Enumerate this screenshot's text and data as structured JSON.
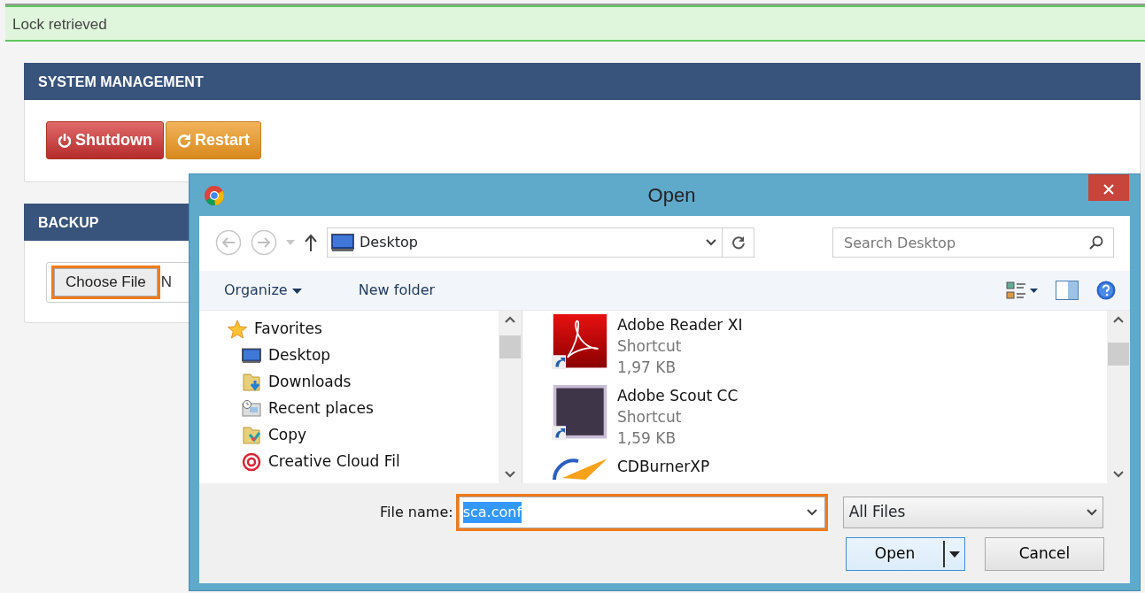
{
  "alert": {
    "text": "Lock retrieved"
  },
  "panels": [
    {
      "title": "SYSTEM MANAGEMENT",
      "buttons": [
        {
          "label": "Shutdown",
          "kind": "danger"
        },
        {
          "label": "Restart",
          "kind": "warning"
        }
      ]
    },
    {
      "title": "BACKUP",
      "file_input": {
        "button": "Choose File",
        "status": "N",
        "highlighted": true
      }
    }
  ],
  "dialog": {
    "title": "Open",
    "address": "Desktop",
    "search_placeholder": "Search Desktop",
    "organize": "Organize",
    "new_folder": "New folder",
    "nav": [
      {
        "label": "Favorites",
        "kind": "favorites"
      },
      {
        "label": "Desktop",
        "kind": "desktop"
      },
      {
        "label": "Downloads",
        "kind": "downloads"
      },
      {
        "label": "Recent places",
        "kind": "recent"
      },
      {
        "label": "Copy",
        "kind": "copy"
      },
      {
        "label": "Creative Cloud Fil",
        "kind": "cloud"
      }
    ],
    "files": [
      {
        "name": "Adobe Reader XI",
        "type": "Shortcut",
        "size": "1,97 KB",
        "kind": "reader"
      },
      {
        "name": "Adobe Scout CC",
        "type": "Shortcut",
        "size": "1,59 KB",
        "kind": "scout"
      },
      {
        "name": "CDBurnerXP",
        "kind": "burner"
      }
    ],
    "file_name_label": "File name:",
    "file_name": "sca.conf",
    "file_name_highlighted": true,
    "filter": "All Files",
    "open_button": "Open",
    "cancel_button": "Cancel"
  }
}
